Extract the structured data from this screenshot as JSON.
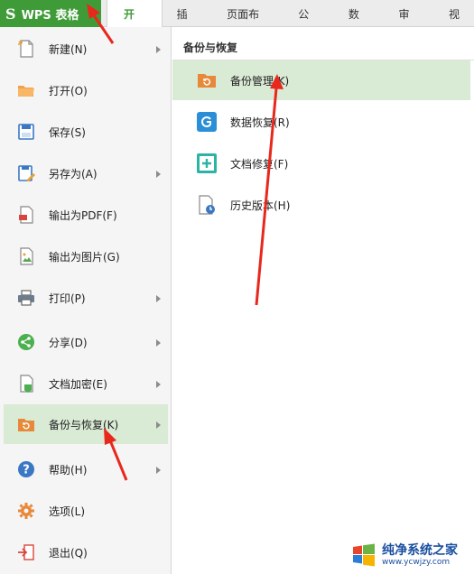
{
  "topbar": {
    "app_label": "WPS 表格",
    "logo_glyph": "S",
    "tabs": [
      "开始",
      "插入",
      "页面布局",
      "公式",
      "数据",
      "审阅",
      "视"
    ]
  },
  "menu": {
    "items": [
      {
        "label": "新建(N)",
        "icon": "new-file-icon",
        "arrow": true
      },
      {
        "label": "打开(O)",
        "icon": "open-folder-icon",
        "arrow": false
      },
      {
        "label": "保存(S)",
        "icon": "save-disk-icon",
        "arrow": false
      },
      {
        "label": "另存为(A)",
        "icon": "save-as-icon",
        "arrow": true
      },
      {
        "label": "输出为PDF(F)",
        "icon": "pdf-export-icon",
        "arrow": false
      },
      {
        "label": "输出为图片(G)",
        "icon": "image-export-icon",
        "arrow": false
      },
      {
        "label": "打印(P)",
        "icon": "printer-icon",
        "arrow": true
      },
      {
        "label": "分享(D)",
        "icon": "share-icon",
        "arrow": true
      },
      {
        "label": "文档加密(E)",
        "icon": "encrypt-doc-icon",
        "arrow": true
      },
      {
        "label": "备份与恢复(K)",
        "icon": "backup-folder-icon",
        "arrow": true,
        "active": true
      },
      {
        "label": "帮助(H)",
        "icon": "help-icon",
        "arrow": true
      },
      {
        "label": "选项(L)",
        "icon": "gear-icon",
        "arrow": false
      },
      {
        "label": "退出(Q)",
        "icon": "exit-icon",
        "arrow": false
      }
    ]
  },
  "submenu": {
    "title": "备份与恢复",
    "items": [
      {
        "label": "备份管理(K)",
        "icon": "backup-folder-icon",
        "active": true
      },
      {
        "label": "数据恢复(R)",
        "icon": "data-recovery-icon"
      },
      {
        "label": "文档修复(F)",
        "icon": "doc-repair-icon"
      },
      {
        "label": "历史版本(H)",
        "icon": "history-version-icon"
      }
    ]
  },
  "colors": {
    "brand_green": "#3f9b37",
    "active_bg": "#d9ead5",
    "annotation_red": "#e8281c"
  },
  "watermark": {
    "name": "纯净系统之家",
    "url": "www.ycwjzy.com"
  }
}
